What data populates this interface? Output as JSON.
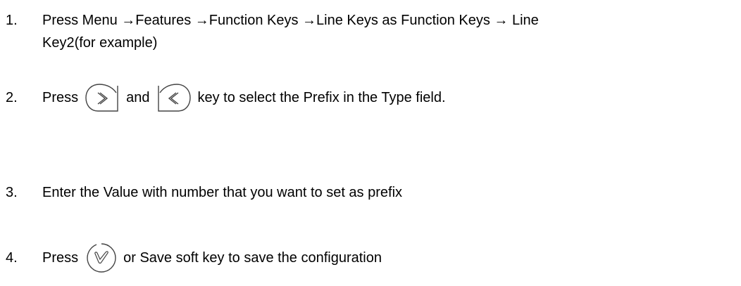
{
  "steps": [
    {
      "number": "1.",
      "line1": "Press Menu →Features →Function Keys →Line Keys as Function Keys → Line",
      "line2": "Key2(for example)"
    },
    {
      "number": "2.",
      "text_before": "Press",
      "text_middle": "and",
      "text_after": "key to select the Prefix in the Type field.",
      "icons": [
        "right-arrow-key-icon",
        "left-arrow-key-icon"
      ]
    },
    {
      "number": "3.",
      "text": "Enter the Value with number that you want to set as prefix"
    },
    {
      "number": "4.",
      "text_before": "Press",
      "text_after": "or Save soft key to save the configuration",
      "icons": [
        "ok-check-key-icon"
      ]
    }
  ]
}
